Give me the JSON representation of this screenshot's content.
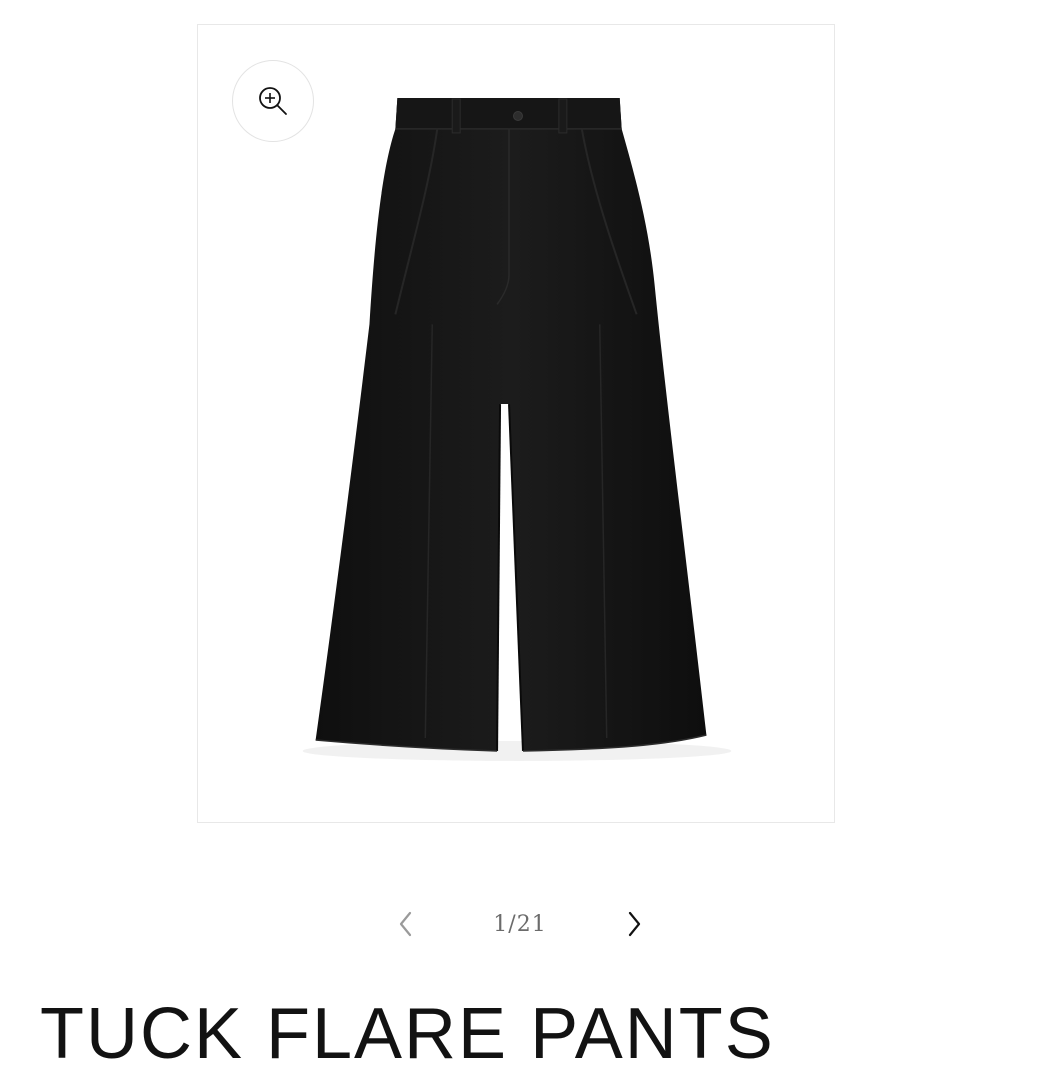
{
  "product": {
    "title": "TUCK FLARE PANTS",
    "color": "#141414"
  },
  "gallery": {
    "zoom_icon": "zoom-in-icon",
    "prev_icon": "chevron-left-icon",
    "next_icon": "chevron-right-icon",
    "counter": "1/21"
  }
}
